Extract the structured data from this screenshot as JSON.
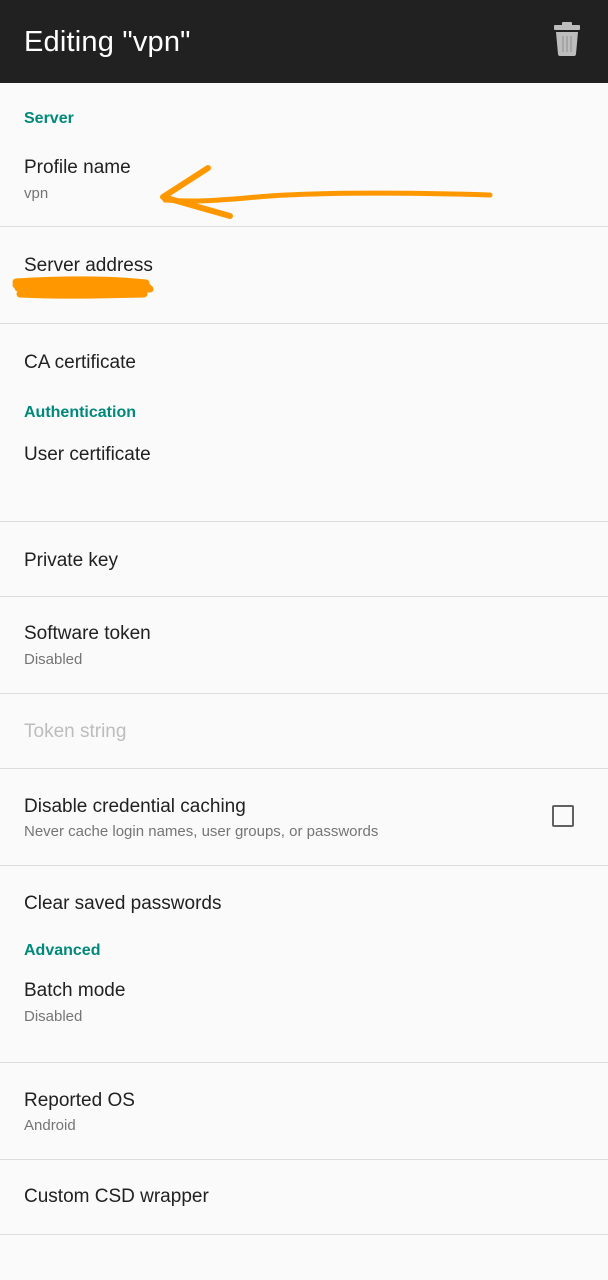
{
  "appbar": {
    "title": "Editing \"vpn\"",
    "delete_icon": "trash-icon"
  },
  "sections": {
    "server": "Server",
    "authentication": "Authentication",
    "advanced": "Advanced"
  },
  "prefs": {
    "profile_name": {
      "title": "Profile name",
      "summary": "vpn"
    },
    "server_address": {
      "title": "Server address"
    },
    "ca_certificate": {
      "title": "CA certificate"
    },
    "user_certificate": {
      "title": "User certificate"
    },
    "private_key": {
      "title": "Private key"
    },
    "software_token": {
      "title": "Software token",
      "summary": "Disabled"
    },
    "token_string": {
      "title": "Token string"
    },
    "disable_credential_caching": {
      "title": "Disable credential caching",
      "summary": "Never cache login names, user groups, or passwords",
      "checked": false
    },
    "clear_saved_passwords": {
      "title": "Clear saved passwords"
    },
    "batch_mode": {
      "title": "Batch mode",
      "summary": "Disabled"
    },
    "reported_os": {
      "title": "Reported OS",
      "summary": "Android"
    },
    "custom_csd_wrapper": {
      "title": "Custom CSD wrapper"
    }
  },
  "colors": {
    "appbar_bg": "#212121",
    "section_header": "#00897b",
    "annotation": "#ff9800",
    "background": "#fafafa"
  },
  "annotations": {
    "arrow": "arrow-annotation",
    "redaction": "redaction-scribble"
  }
}
